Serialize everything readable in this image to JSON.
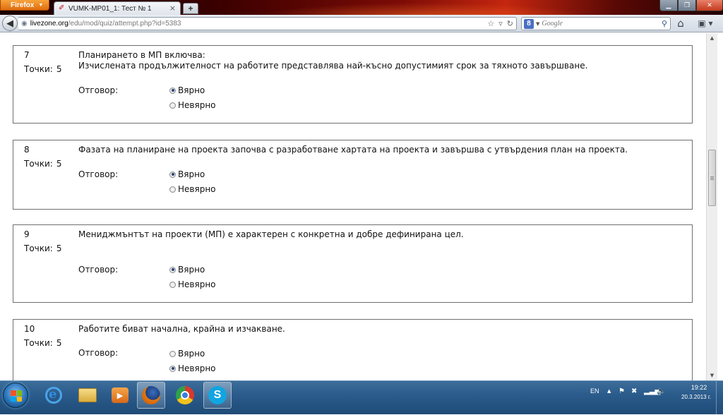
{
  "browser": {
    "app_button": "Firefox",
    "tab_title": "VUMK-MP01_1: Тест № 1",
    "url_host": "livezone.org",
    "url_path": "/edu/mod/quiz/attempt.php?id=5383",
    "search_placeholder": "Google",
    "search_engine_letter": "8"
  },
  "quiz": {
    "points_label": "Точки:",
    "answer_label": "Отговор:",
    "questions": [
      {
        "number": "7",
        "points": "5",
        "text_line1": "Планирането в МП включва:",
        "text_line2": "Изчислената продължителност на работите представлява най-късно допустимият срок за тяхното завършване.",
        "options": [
          {
            "label": "Вярно",
            "selected": true
          },
          {
            "label": "Невярно",
            "selected": false
          }
        ]
      },
      {
        "number": "8",
        "points": "5",
        "text_line1": "Фазата на планиране на проекта започва с разработване хартата на проекта и завършва с утвърдения план на проекта.",
        "text_line2": "",
        "options": [
          {
            "label": "Вярно",
            "selected": true
          },
          {
            "label": "Невярно",
            "selected": false
          }
        ]
      },
      {
        "number": "9",
        "points": "5",
        "text_line1": "Мениджмънтът на проекти (МП) е характерен с конкретна и добре дефинирана цел.",
        "text_line2": "",
        "options": [
          {
            "label": "Вярно",
            "selected": true
          },
          {
            "label": "Невярно",
            "selected": false
          }
        ]
      },
      {
        "number": "10",
        "points": "5",
        "text_line1": "Работите биват начална, крайна и изчакване.",
        "text_line2": "",
        "options": [
          {
            "label": "Вярно",
            "selected": false
          },
          {
            "label": "Невярно",
            "selected": true
          }
        ]
      }
    ]
  },
  "taskbar": {
    "language": "EN",
    "time": "19:22",
    "date": "20.3.2013 г."
  },
  "icons": {
    "back": "back-arrow-icon",
    "home": "home-icon",
    "search": "magnifier-icon",
    "start": "windows-start-icon"
  },
  "colors": {
    "radio_selected": "#24457a",
    "taskbar": "#2b5c8c",
    "firefox_orange": "#e06d0d"
  }
}
